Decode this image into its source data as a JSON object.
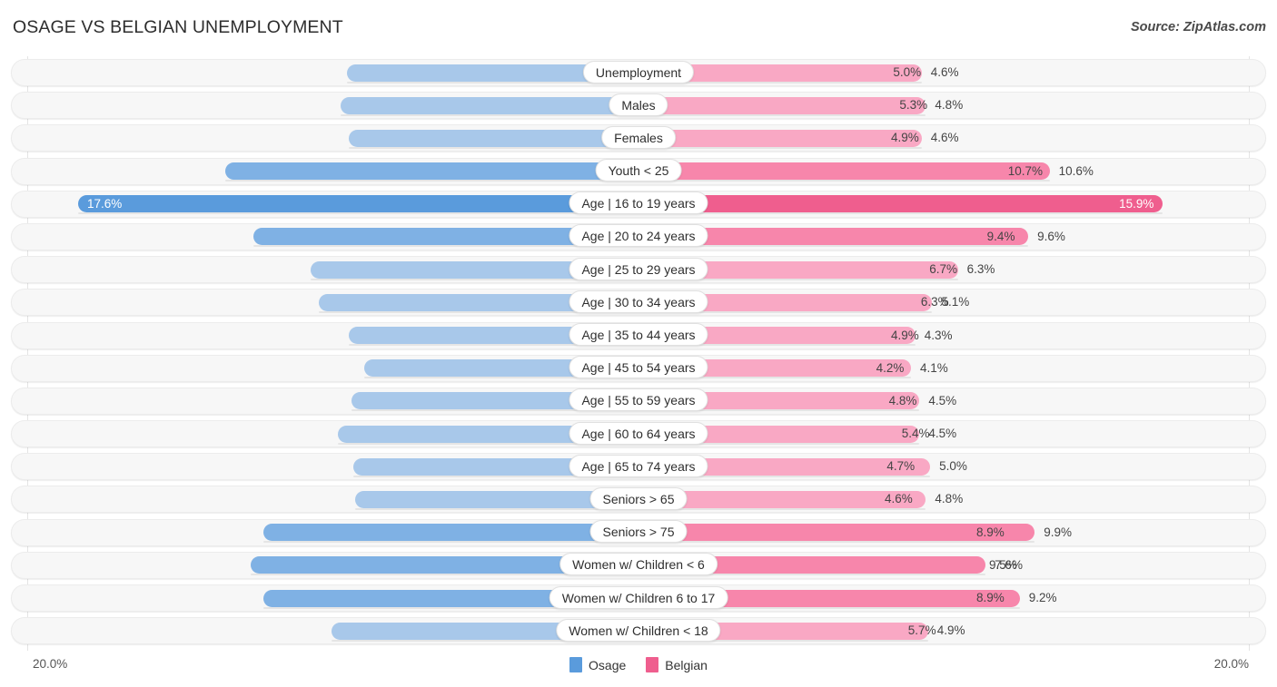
{
  "header": {
    "title": "OSAGE VS BELGIAN UNEMPLOYMENT",
    "source": "Source: ZipAtlas.com"
  },
  "footer": {
    "axis_left": "20.0%",
    "axis_right": "20.0%",
    "legend": [
      {
        "label": "Osage",
        "color": "#5a9bdc"
      },
      {
        "label": "Belgian",
        "color": "#ef5e8e"
      }
    ]
  },
  "colors": {
    "left_light": "#a8c8ea",
    "left_mid": "#7fb1e4",
    "left_strong": "#5a9bdc",
    "right_light": "#f9a8c4",
    "right_mid": "#f786ab",
    "right_strong": "#ef5e8e",
    "track": "#f7f7f7",
    "gridline": "#e4e4e4"
  },
  "chart_data": {
    "type": "bar",
    "title": "OSAGE VS BELGIAN UNEMPLOYMENT",
    "subtype": "diverging-bar",
    "xlabel": "",
    "ylabel": "",
    "xlim": [
      20.0,
      20.0
    ],
    "axis_max_percent": 20.0,
    "grid": true,
    "legend_position": "bottom-center",
    "series": [
      {
        "name": "Osage",
        "side": "left",
        "color": "#5a9bdc",
        "values": [
          5.0,
          5.3,
          4.9,
          10.7,
          17.6,
          9.4,
          6.7,
          6.3,
          4.9,
          4.2,
          4.8,
          5.4,
          4.7,
          4.6,
          8.9,
          9.5,
          8.9,
          5.7
        ]
      },
      {
        "name": "Belgian",
        "side": "right",
        "color": "#ef5e8e",
        "values": [
          4.6,
          4.8,
          4.6,
          10.6,
          15.9,
          9.6,
          6.3,
          5.1,
          4.3,
          4.1,
          4.5,
          4.5,
          5.0,
          4.8,
          9.9,
          7.6,
          9.2,
          4.9
        ]
      }
    ],
    "categories": [
      "Unemployment",
      "Males",
      "Females",
      "Youth < 25",
      "Age | 16 to 19 years",
      "Age | 20 to 24 years",
      "Age | 25 to 29 years",
      "Age | 30 to 34 years",
      "Age | 35 to 44 years",
      "Age | 45 to 54 years",
      "Age | 55 to 59 years",
      "Age | 60 to 64 years",
      "Age | 65 to 74 years",
      "Seniors > 65",
      "Seniors > 75",
      "Women w/ Children < 6",
      "Women w/ Children 6 to 17",
      "Women w/ Children < 18"
    ]
  },
  "rows": [
    {
      "label": "Unemployment",
      "left_value": "5.0%",
      "right_value": "4.6%",
      "left_num": 5.0,
      "right_num": 4.6,
      "intensity": "light"
    },
    {
      "label": "Males",
      "left_value": "5.3%",
      "right_value": "4.8%",
      "left_num": 5.3,
      "right_num": 4.8,
      "intensity": "light"
    },
    {
      "label": "Females",
      "left_value": "4.9%",
      "right_value": "4.6%",
      "left_num": 4.9,
      "right_num": 4.6,
      "intensity": "light"
    },
    {
      "label": "Youth < 25",
      "left_value": "10.7%",
      "right_value": "10.6%",
      "left_num": 10.7,
      "right_num": 10.6,
      "intensity": "mid"
    },
    {
      "label": "Age | 16 to 19 years",
      "left_value": "17.6%",
      "right_value": "15.9%",
      "left_num": 17.6,
      "right_num": 15.9,
      "intensity": "strong"
    },
    {
      "label": "Age | 20 to 24 years",
      "left_value": "9.4%",
      "right_value": "9.6%",
      "left_num": 9.4,
      "right_num": 9.6,
      "intensity": "mid"
    },
    {
      "label": "Age | 25 to 29 years",
      "left_value": "6.7%",
      "right_value": "6.3%",
      "left_num": 6.7,
      "right_num": 6.3,
      "intensity": "light"
    },
    {
      "label": "Age | 30 to 34 years",
      "left_value": "6.3%",
      "right_value": "5.1%",
      "left_num": 6.3,
      "right_num": 5.1,
      "intensity": "light"
    },
    {
      "label": "Age | 35 to 44 years",
      "left_value": "4.9%",
      "right_value": "4.3%",
      "left_num": 4.9,
      "right_num": 4.3,
      "intensity": "light"
    },
    {
      "label": "Age | 45 to 54 years",
      "left_value": "4.2%",
      "right_value": "4.1%",
      "left_num": 4.2,
      "right_num": 4.1,
      "intensity": "light"
    },
    {
      "label": "Age | 55 to 59 years",
      "left_value": "4.8%",
      "right_value": "4.5%",
      "left_num": 4.8,
      "right_num": 4.5,
      "intensity": "light"
    },
    {
      "label": "Age | 60 to 64 years",
      "left_value": "5.4%",
      "right_value": "4.5%",
      "left_num": 5.4,
      "right_num": 4.5,
      "intensity": "light"
    },
    {
      "label": "Age | 65 to 74 years",
      "left_value": "4.7%",
      "right_value": "5.0%",
      "left_num": 4.7,
      "right_num": 5.0,
      "intensity": "light"
    },
    {
      "label": "Seniors > 65",
      "left_value": "4.6%",
      "right_value": "4.8%",
      "left_num": 4.6,
      "right_num": 4.8,
      "intensity": "light"
    },
    {
      "label": "Seniors > 75",
      "left_value": "8.9%",
      "right_value": "9.9%",
      "left_num": 8.9,
      "right_num": 9.9,
      "intensity": "mid"
    },
    {
      "label": "Women w/ Children < 6",
      "left_value": "9.5%",
      "right_value": "7.6%",
      "left_num": 9.5,
      "right_num": 7.6,
      "intensity": "mid"
    },
    {
      "label": "Women w/ Children 6 to 17",
      "left_value": "8.9%",
      "right_value": "9.2%",
      "left_num": 8.9,
      "right_num": 9.2,
      "intensity": "mid"
    },
    {
      "label": "Women w/ Children < 18",
      "left_value": "5.7%",
      "right_value": "4.9%",
      "left_num": 5.7,
      "right_num": 4.9,
      "intensity": "light"
    }
  ]
}
